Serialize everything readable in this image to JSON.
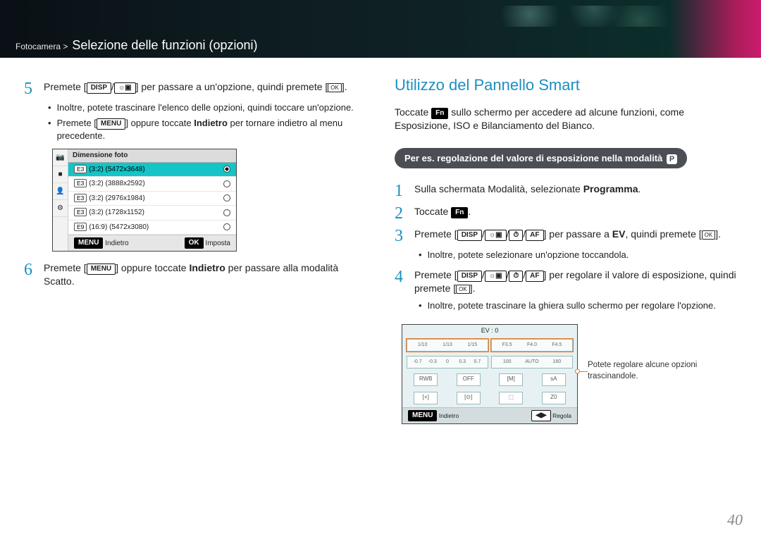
{
  "breadcrumb": {
    "parent": "Fotocamera >",
    "title": "Selezione delle funzioni (opzioni)"
  },
  "left": {
    "step5": {
      "num": "5",
      "pre": "Premete [",
      "btn1": "DISP",
      "slash": "/",
      "btn2_icon": "exposure-icon",
      "mid": "] per passare a un'opzione, quindi premete [",
      "ok": "OK",
      "post": "]."
    },
    "b51": "Inoltre, potete trascinare l'elenco delle opzioni, quindi toccare un'opzione.",
    "b52_pre": "Premete [",
    "b52_btn": "MENU",
    "b52_mid": "] oppure toccate ",
    "b52_bold": "Indietro",
    "b52_post": " per tornare indietro al menu precedente.",
    "menu": {
      "header": "Dimensione foto",
      "tabs": [
        "📷",
        "■",
        "👤",
        "⚙"
      ],
      "rows": [
        {
          "badge": "E3",
          "label": "(3:2) (5472x3648)",
          "sel": true
        },
        {
          "badge": "E3",
          "label": "(3:2) (3888x2592)",
          "sel": false
        },
        {
          "badge": "E3",
          "label": "(3:2) (2976x1984)",
          "sel": false
        },
        {
          "badge": "E3",
          "label": "(3:2) (1728x1152)",
          "sel": false
        },
        {
          "badge": "E9",
          "label": "(16:9) (5472x3080)",
          "sel": false
        }
      ],
      "footer_left": "MENU",
      "footer_left_txt": "Indietro",
      "footer_right": "OK",
      "footer_right_txt": "Imposta"
    },
    "step6": {
      "num": "6",
      "pre": "Premete [",
      "btn": "MENU",
      "mid": "] oppure toccate ",
      "bold": "Indietro",
      "post": " per passare alla modalità Scatto."
    }
  },
  "right": {
    "title": "Utilizzo del Pannello Smart",
    "intro_pre": "Toccate ",
    "intro_btn": "Fn",
    "intro_post": " sullo schermo per accedere ad alcune funzioni, come Esposizione, ISO e Bilanciamento del Bianco.",
    "callout": "Per es. regolazione del valore di esposizione nella modalità",
    "callout_p": "P",
    "s1": {
      "num": "1",
      "txt_pre": "Sulla schermata Modalità, selezionate ",
      "bold": "Programma",
      "txt_post": "."
    },
    "s2": {
      "num": "2",
      "pre": "Toccate ",
      "btn": "Fn",
      "post": "."
    },
    "s3": {
      "num": "3",
      "pre": "Premete [",
      "b1": "DISP",
      "sl1": "/",
      "b2": "exposure-icon",
      "sl2": "/",
      "b3": "timer-icon",
      "sl3": "/",
      "b4": "AF",
      "mid": "] per passare a ",
      "bold": "EV",
      "post1": ", quindi premete [",
      "ok": "OK",
      "post2": "]."
    },
    "s3_bullet": "Inoltre, potete selezionare un'opzione toccandola.",
    "s4": {
      "num": "4",
      "pre": "Premete [",
      "b1": "DISP",
      "sl1": "/",
      "b2": "exposure-icon",
      "sl2": "/",
      "b3": "timer-icon",
      "sl3": "/",
      "b4": "AF",
      "mid": "] per regolare il valore di esposizione, quindi premete [",
      "ok": "OK",
      "post": "]."
    },
    "s4_bullet": "Inoltre, potete trascinare la ghiera sullo schermo per regolare l'opzione.",
    "ev": {
      "title": "EV : 0",
      "scale1": [
        "1/10",
        "1/13",
        "1/15"
      ],
      "scale2": [
        "F3.5",
        "F4.0",
        "F4.5"
      ],
      "scale3": [
        "-0.7",
        "-0.3",
        "0",
        "0.3",
        "0.7"
      ],
      "scale4": [
        "100",
        "AUTO",
        "160"
      ],
      "btns1": [
        "RWB",
        "OFF",
        "[M]",
        "sA"
      ],
      "btns2": [
        "[+]",
        "[⊙]",
        "⬚",
        "Z0"
      ],
      "footer_left_btn": "MENU",
      "footer_left_txt": "Indietro",
      "footer_right_btn": "◀▶",
      "footer_right_txt": "Regola"
    },
    "ev_caption": "Potete regolare alcune opzioni trascinandole."
  },
  "page_number": "40"
}
